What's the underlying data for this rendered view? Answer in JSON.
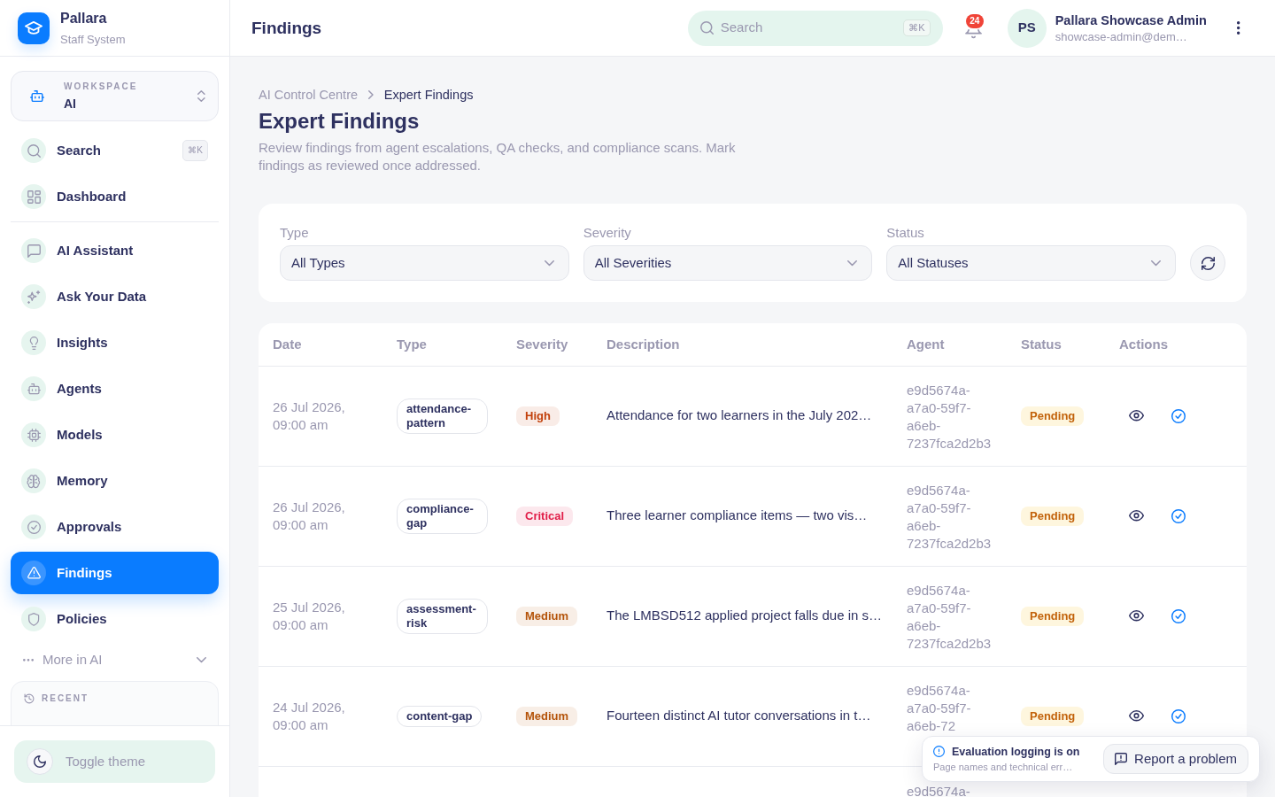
{
  "sidebar": {
    "brand": {
      "name": "Pallara",
      "subtitle": "Staff System"
    },
    "workspace": {
      "label": "WORKSPACE",
      "value": "AI"
    },
    "nav_groups": [
      [
        {
          "label": "Search",
          "shortcut": "⌘K",
          "selected": false
        },
        {
          "label": "Dashboard",
          "selected": false
        }
      ],
      [
        {
          "label": "AI Assistant",
          "selected": false
        },
        {
          "label": "Ask Your Data",
          "selected": false
        },
        {
          "label": "Insights",
          "selected": false
        },
        {
          "label": "Agents",
          "selected": false
        },
        {
          "label": "Models",
          "selected": false
        },
        {
          "label": "Memory",
          "selected": false
        },
        {
          "label": "Approvals",
          "selected": false
        },
        {
          "label": "Findings",
          "selected": true
        },
        {
          "label": "Policies",
          "selected": false
        }
      ]
    ],
    "more": {
      "label": "More in AI",
      "expanded": false
    },
    "recent": {
      "title": "RECENT"
    },
    "theme_toggle": {
      "label": "Toggle theme"
    }
  },
  "header": {
    "title": "Findings",
    "search": {
      "placeholder": "Search",
      "shortcut": "⌘K"
    },
    "notification_count": "24",
    "user": {
      "initials": "PS",
      "name": "Pallara Showcase Admin",
      "email": "showcase-admin@dem…"
    }
  },
  "page": {
    "breadcrumb": [
      "AI Control Centre",
      "Expert Findings"
    ],
    "title": "Expert Findings",
    "description": "Review findings from agent escalations, QA checks, and compliance scans. Mark findings as reviewed once addressed."
  },
  "filters": [
    {
      "label": "Type",
      "value": "All Types"
    },
    {
      "label": "Severity",
      "value": "All Severities"
    },
    {
      "label": "Status",
      "value": "All Statuses"
    }
  ],
  "table": {
    "columns": [
      "Date",
      "Type",
      "Severity",
      "Description",
      "Agent",
      "Status",
      "Actions"
    ],
    "rows": [
      {
        "date": "26 Jul 2026, 09:00 am",
        "type": "attendance-pattern",
        "severity": {
          "label": "High",
          "color": "#c2410c"
        },
        "description": "Attendance for two learners in the July 202…",
        "agent": "e9d5674a-a7a0-59f7-a6eb-7237fca2d2b3",
        "status": "Pending"
      },
      {
        "date": "26 Jul 2026, 09:00 am",
        "type": "compliance-gap",
        "severity": {
          "label": "Critical",
          "color": "#e11d48"
        },
        "description": "Three learner compliance items — two vis…",
        "agent": "e9d5674a-a7a0-59f7-a6eb-7237fca2d2b3",
        "status": "Pending"
      },
      {
        "date": "25 Jul 2026, 09:00 am",
        "type": "assessment-risk",
        "severity": {
          "label": "Medium",
          "color": "#b45309"
        },
        "description": "The LMBSD512 applied project falls due in s…",
        "agent": "e9d5674a-a7a0-59f7-a6eb-7237fca2d2b3",
        "status": "Pending"
      },
      {
        "date": "24 Jul 2026, 09:00 am",
        "type": "content-gap",
        "severity": {
          "label": "Medium",
          "color": "#b45309"
        },
        "description": "Fourteen distinct AI tutor conversations in t…",
        "agent": "e9d5674a-a7a0-59f7-a6eb-72",
        "status": "Pending"
      },
      {
        "agent": "e9d5674a-"
      }
    ]
  },
  "toast": {
    "title": "Evaluation logging is on",
    "message": "Page names and technical err…",
    "button": "Report a problem"
  }
}
